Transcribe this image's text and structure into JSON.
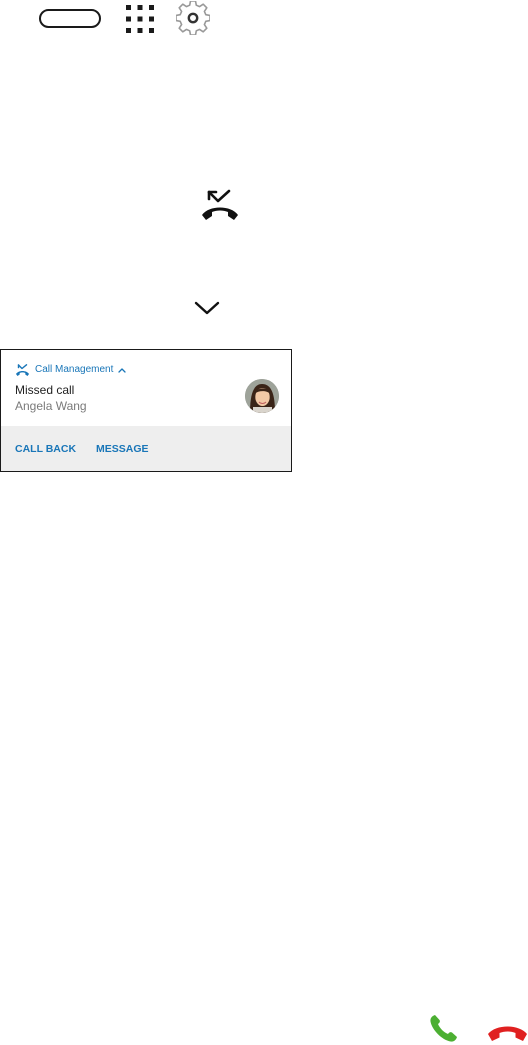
{
  "toolbar": {
    "icons": [
      "home-pill-icon",
      "app-grid-icon",
      "gear-icon"
    ]
  },
  "missed_call_icon": "missed-call-icon",
  "expand_icon": "chevron-down-icon",
  "notification": {
    "app_name": "Call Management",
    "title": "Missed call",
    "text": "Angela Wang",
    "avatar": "contact-avatar",
    "actions": [
      {
        "label": "CALL BACK"
      },
      {
        "label": "MESSAGE"
      }
    ]
  },
  "call_controls": {
    "answer_icon": "phone-answer-icon",
    "decline_icon": "phone-decline-icon"
  },
  "colors": {
    "accent": "#1976b8",
    "answer": "#4caf32",
    "decline": "#e02020",
    "actions_bg": "#eeeeee"
  }
}
